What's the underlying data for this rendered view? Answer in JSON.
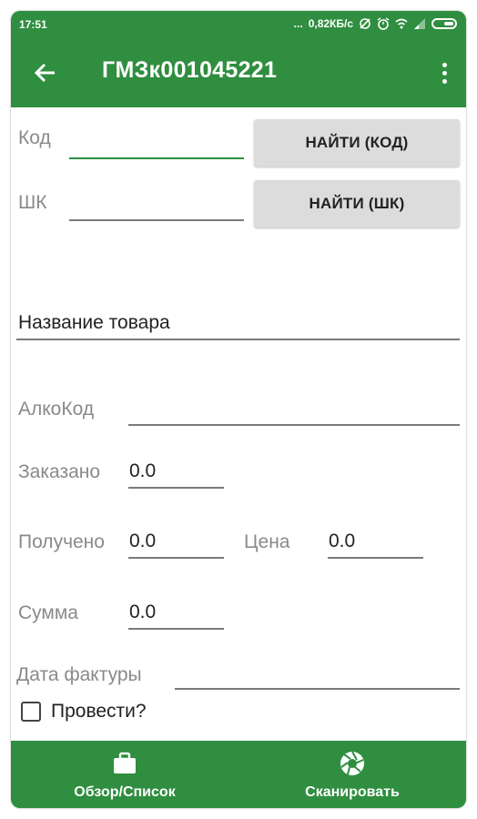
{
  "status_bar": {
    "time": "17:51",
    "speed": "0,82КБ/с",
    "dots": "..."
  },
  "app_bar": {
    "title": "ГМЗк001045221"
  },
  "form": {
    "kod_label": "Код",
    "kod_value": "",
    "find_code_button": "НАЙТИ (КОД)",
    "shk_label": "ШК",
    "shk_value": "",
    "find_shk_button": "НАЙТИ (ШК)",
    "product_name": "Название товара",
    "alko_label": "АлкоКод",
    "alko_value": "",
    "ordered_label": "Заказано",
    "ordered_value": "0.0",
    "received_label": "Получено",
    "received_value": "0.0",
    "price_label": "Цена",
    "price_value": "0.0",
    "sum_label": "Сумма",
    "sum_value": "0.0",
    "invoice_date_label": "Дата фактуры",
    "invoice_date_value": "",
    "post_checkbox_label": "Провести?",
    "post_checked": false
  },
  "bottom_nav": {
    "overview_label": "Обзор/Список",
    "scan_label": "Сканировать"
  },
  "colors": {
    "accent": "#2f8e3f",
    "button_bg": "#dcdcdc",
    "label": "#8a8a8a"
  }
}
